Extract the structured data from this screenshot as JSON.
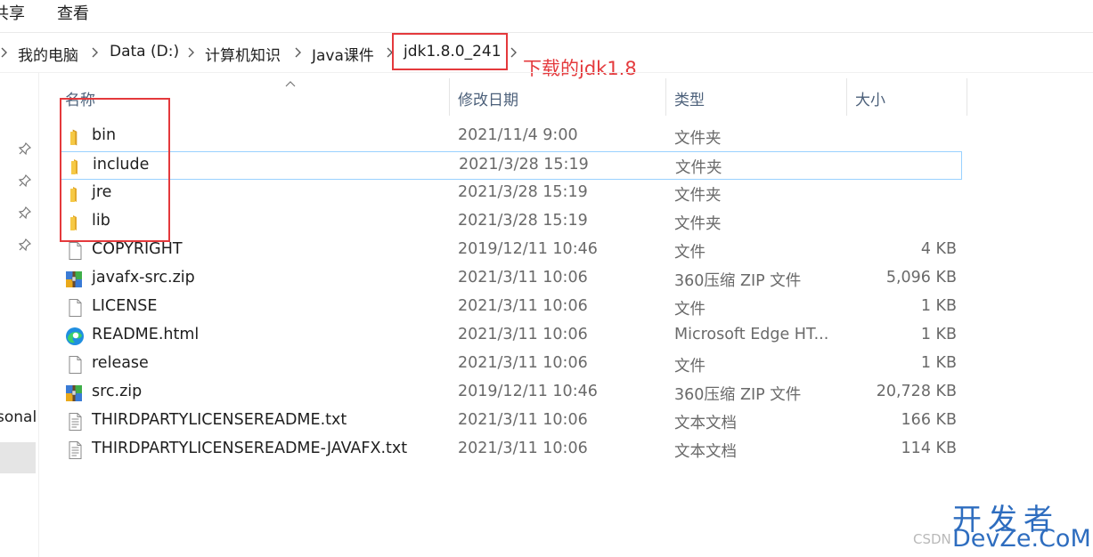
{
  "ribbon": {
    "share_label": "共享",
    "view_label": "查看"
  },
  "breadcrumb": {
    "items": [
      "我的电脑",
      "Data (D:)",
      "计算机知识",
      "Java课件"
    ],
    "current": "jdk1.8.0_241"
  },
  "annotation": {
    "text": "下载的jdk1.8",
    "color": "#e4393c"
  },
  "nav_pane": {
    "partial_label": "sonal"
  },
  "columns": {
    "name": "名称",
    "date": "修改日期",
    "type": "类型",
    "size": "大小"
  },
  "files": [
    {
      "name": "bin",
      "date": "2021/11/4 9:00",
      "type": "文件夹",
      "size": "",
      "icon": "folder-icon"
    },
    {
      "name": "include",
      "date": "2021/3/28 15:19",
      "type": "文件夹",
      "size": "",
      "icon": "folder-icon"
    },
    {
      "name": "jre",
      "date": "2021/3/28 15:19",
      "type": "文件夹",
      "size": "",
      "icon": "folder-icon"
    },
    {
      "name": "lib",
      "date": "2021/3/28 15:19",
      "type": "文件夹",
      "size": "",
      "icon": "folder-icon"
    },
    {
      "name": "COPYRIGHT",
      "date": "2019/12/11 10:46",
      "type": "文件",
      "size": "4 KB",
      "icon": "file-icon"
    },
    {
      "name": "javafx-src.zip",
      "date": "2021/3/11 10:06",
      "type": "360压缩 ZIP 文件",
      "size": "5,096 KB",
      "icon": "zip-archive-icon"
    },
    {
      "name": "LICENSE",
      "date": "2021/3/11 10:06",
      "type": "文件",
      "size": "1 KB",
      "icon": "file-icon"
    },
    {
      "name": "README.html",
      "date": "2021/3/11 10:06",
      "type": "Microsoft Edge HT...",
      "size": "1 KB",
      "icon": "edge-browser-icon"
    },
    {
      "name": "release",
      "date": "2021/3/11 10:06",
      "type": "文件",
      "size": "1 KB",
      "icon": "file-icon"
    },
    {
      "name": "src.zip",
      "date": "2019/12/11 10:46",
      "type": "360压缩 ZIP 文件",
      "size": "20,728 KB",
      "icon": "zip-archive-icon"
    },
    {
      "name": "THIRDPARTYLICENSEREADME.txt",
      "date": "2021/3/11 10:06",
      "type": "文本文档",
      "size": "166 KB",
      "icon": "text-document-icon"
    },
    {
      "name": "THIRDPARTYLICENSEREADME-JAVAFX.txt",
      "date": "2021/3/11 10:06",
      "type": "文本文档",
      "size": "114 KB",
      "icon": "text-document-icon"
    }
  ],
  "watermark": {
    "logo": "开发者",
    "domain": "DevZe.CoM",
    "source": "CSDN"
  },
  "colors": {
    "highlight_box": "#e4393c",
    "selection_border": "#99d1ff",
    "folder": "#f5c440",
    "watermark": "#2e6dbf"
  }
}
